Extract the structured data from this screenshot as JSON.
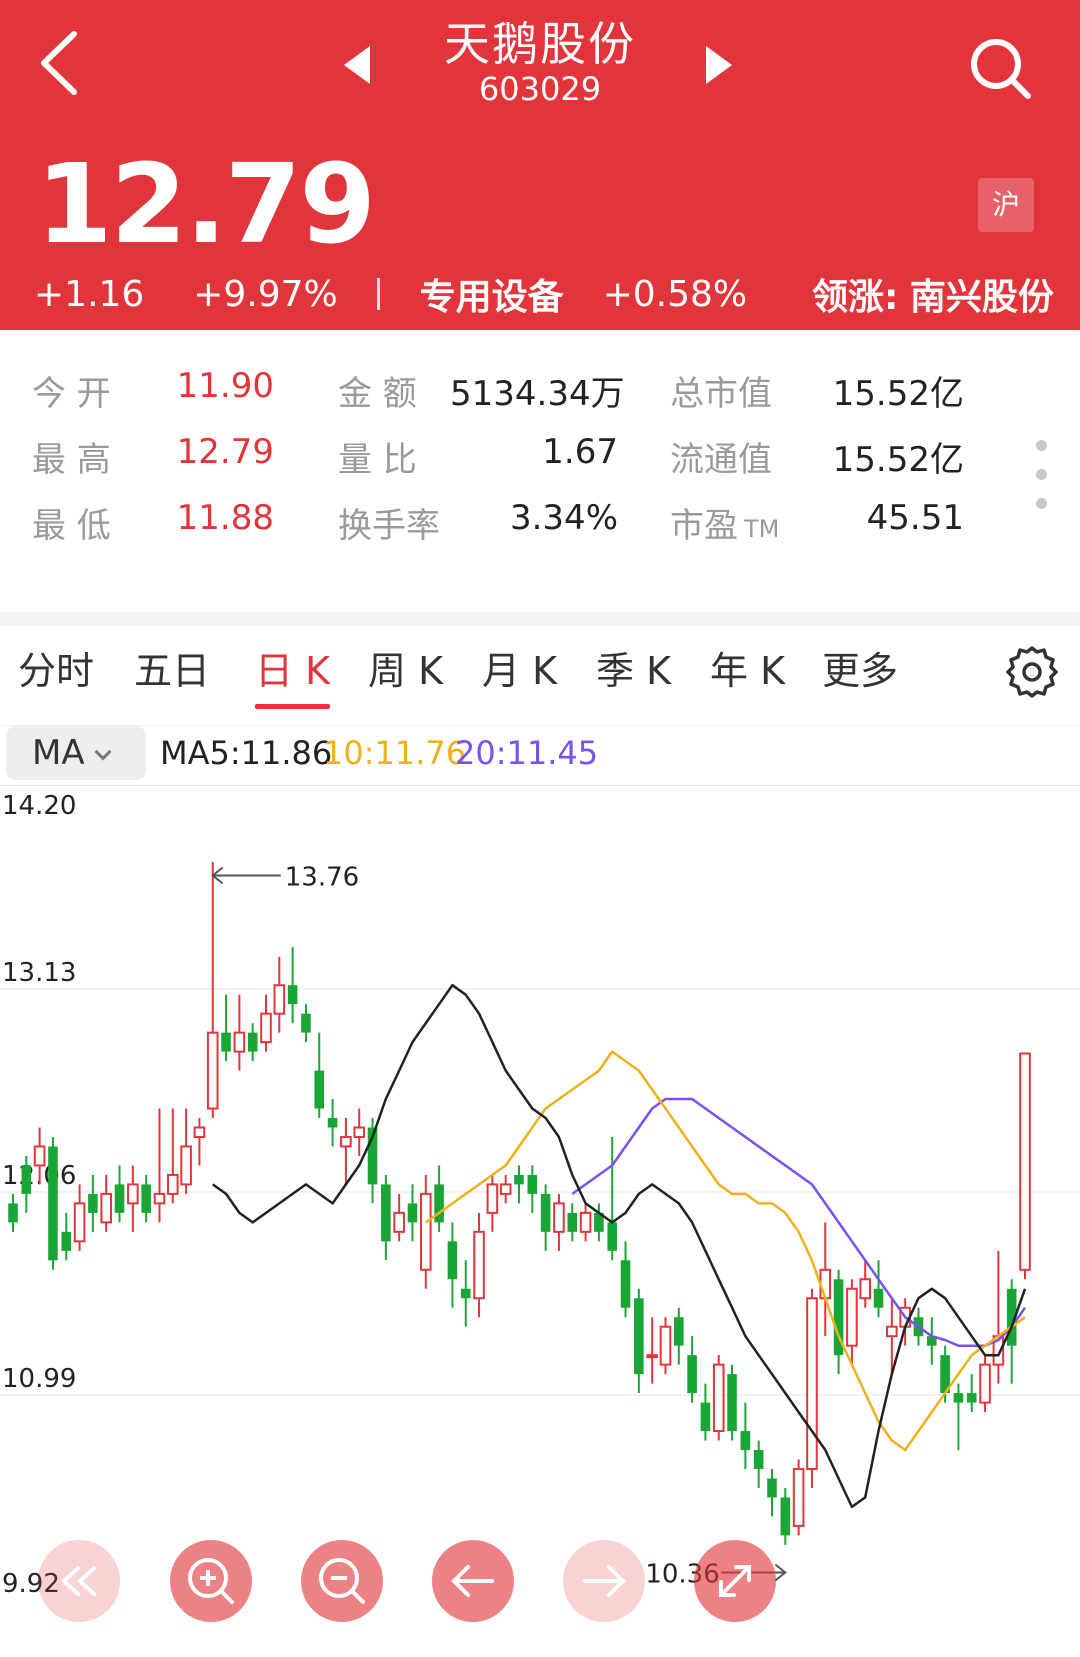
{
  "header": {
    "stock_name": "天鹅股份",
    "stock_code": "603029",
    "price": "12.79",
    "exchange_badge": "沪",
    "change": "+1.16",
    "change_pct": "+9.97%",
    "sector_name": "专用设备",
    "sector_change": "+0.58%",
    "leader_label": "领涨:",
    "leader_name": "南兴股份"
  },
  "stats": {
    "open_label": "今 开",
    "open_value": "11.90",
    "high_label": "最 高",
    "high_value": "12.79",
    "low_label": "最 低",
    "low_value": "11.88",
    "amount_label": "金 额",
    "amount_value": "5134.34万",
    "vol_ratio_label": "量 比",
    "vol_ratio_value": "1.67",
    "turnover_label": "换手率",
    "turnover_value": "3.34%",
    "mktcap_label": "总市值",
    "mktcap_value": "15.52亿",
    "float_cap_label": "流通值",
    "float_cap_value": "15.52亿",
    "pe_label": "市盈",
    "pe_suffix": "TM",
    "pe_value": "45.51"
  },
  "tabs": [
    {
      "label": "分时"
    },
    {
      "label": "五日"
    },
    {
      "label": "日 K"
    },
    {
      "label": "周 K"
    },
    {
      "label": "月 K"
    },
    {
      "label": "季 K"
    },
    {
      "label": "年 K"
    },
    {
      "label": "更多"
    }
  ],
  "active_tab": "日 K",
  "indicator": {
    "button_label": "MA",
    "ma5": "MA5:11.86",
    "ma10": "10:11.76",
    "ma20": "20:11.45"
  },
  "colors": {
    "header_red": "#e2353b",
    "up": "#e2353b",
    "down": "#1aa637",
    "ma5": "#222222",
    "ma10": "#f0b019",
    "ma20": "#7b4ff0"
  },
  "chart_data": {
    "type": "candlestick",
    "y_ticks": [
      "14.20",
      "13.13",
      "12.06",
      "10.99",
      "9.92"
    ],
    "ylim": [
      9.92,
      14.2
    ],
    "grid": true,
    "max_annotation": "13.76",
    "min_annotation": "10.36",
    "candles": [
      [
        12.0,
        11.9,
        12.05,
        11.85
      ],
      [
        12.2,
        12.05,
        12.25,
        11.95
      ],
      [
        12.2,
        12.3,
        12.4,
        12.1
      ],
      [
        12.3,
        11.7,
        12.35,
        11.65
      ],
      [
        11.85,
        11.75,
        11.95,
        11.7
      ],
      [
        11.8,
        12.0,
        12.1,
        11.75
      ],
      [
        12.05,
        11.95,
        12.15,
        11.85
      ],
      [
        11.9,
        12.05,
        12.15,
        11.85
      ],
      [
        12.1,
        11.95,
        12.2,
        11.9
      ],
      [
        12.0,
        12.1,
        12.2,
        11.85
      ],
      [
        12.1,
        11.95,
        12.15,
        11.9
      ],
      [
        12.0,
        12.05,
        12.5,
        11.9
      ],
      [
        12.05,
        12.15,
        12.5,
        12.0
      ],
      [
        12.1,
        12.3,
        12.5,
        12.05
      ],
      [
        12.35,
        12.4,
        12.45,
        12.2
      ],
      [
        12.5,
        12.9,
        13.8,
        12.45
      ],
      [
        12.9,
        12.8,
        13.1,
        12.75
      ],
      [
        12.8,
        12.9,
        13.1,
        12.7
      ],
      [
        12.9,
        12.8,
        12.95,
        12.75
      ],
      [
        12.85,
        13.0,
        13.1,
        12.8
      ],
      [
        13.0,
        13.15,
        13.3,
        12.9
      ],
      [
        13.15,
        13.05,
        13.35,
        12.95
      ],
      [
        13.0,
        12.9,
        13.05,
        12.85
      ],
      [
        12.7,
        12.5,
        12.9,
        12.45
      ],
      [
        12.45,
        12.4,
        12.55,
        12.3
      ],
      [
        12.3,
        12.35,
        12.45,
        12.1
      ],
      [
        12.35,
        12.4,
        12.5,
        12.25
      ],
      [
        12.4,
        12.1,
        12.45,
        12.0
      ],
      [
        12.1,
        11.8,
        12.15,
        11.7
      ],
      [
        11.85,
        11.95,
        12.05,
        11.8
      ],
      [
        12.0,
        11.9,
        12.1,
        11.8
      ],
      [
        11.65,
        12.05,
        12.15,
        11.55
      ],
      [
        12.1,
        11.9,
        12.2,
        11.85
      ],
      [
        11.8,
        11.6,
        11.9,
        11.45
      ],
      [
        11.55,
        11.5,
        11.7,
        11.35
      ],
      [
        11.5,
        11.85,
        11.95,
        11.4
      ],
      [
        11.95,
        12.1,
        12.15,
        11.85
      ],
      [
        12.05,
        12.1,
        12.15,
        12.0
      ],
      [
        12.15,
        12.1,
        12.2,
        12.0
      ],
      [
        12.15,
        12.05,
        12.2,
        11.95
      ],
      [
        12.05,
        11.85,
        12.1,
        11.75
      ],
      [
        11.85,
        12.0,
        12.05,
        11.75
      ],
      [
        11.95,
        11.85,
        12.0,
        11.8
      ],
      [
        11.85,
        11.95,
        12.0,
        11.8
      ],
      [
        11.95,
        11.85,
        12.0,
        11.8
      ],
      [
        11.9,
        11.75,
        12.35,
        11.7
      ],
      [
        11.7,
        11.45,
        11.8,
        11.4
      ],
      [
        11.5,
        11.1,
        11.55,
        11.0
      ],
      [
        11.2,
        11.2,
        11.4,
        11.05
      ],
      [
        11.15,
        11.35,
        11.4,
        11.1
      ],
      [
        11.4,
        11.25,
        11.45,
        11.15
      ],
      [
        11.2,
        11.0,
        11.3,
        10.95
      ],
      [
        10.95,
        10.8,
        11.05,
        10.75
      ],
      [
        10.8,
        11.15,
        11.2,
        10.75
      ],
      [
        11.1,
        10.8,
        11.15,
        10.75
      ],
      [
        10.8,
        10.7,
        10.95,
        10.6
      ],
      [
        10.7,
        10.6,
        10.75,
        10.5
      ],
      [
        10.55,
        10.45,
        10.6,
        10.35
      ],
      [
        10.45,
        10.25,
        10.5,
        10.2
      ],
      [
        10.3,
        10.6,
        10.65,
        10.25
      ],
      [
        10.6,
        11.5,
        11.55,
        10.5
      ],
      [
        11.5,
        11.65,
        11.9,
        11.3
      ],
      [
        11.6,
        11.2,
        11.65,
        11.1
      ],
      [
        11.25,
        11.55,
        11.6,
        11.15
      ],
      [
        11.5,
        11.6,
        11.7,
        11.45
      ],
      [
        11.55,
        11.45,
        11.7,
        11.4
      ],
      [
        11.3,
        11.35,
        11.5,
        11.1
      ],
      [
        11.35,
        11.45,
        11.5,
        11.25
      ],
      [
        11.4,
        11.3,
        11.45,
        11.25
      ],
      [
        11.3,
        11.25,
        11.4,
        11.15
      ],
      [
        11.2,
        11.0,
        11.25,
        10.95
      ],
      [
        11.0,
        10.95,
        11.05,
        10.7
      ],
      [
        11.0,
        10.95,
        11.1,
        10.9
      ],
      [
        10.95,
        11.15,
        11.2,
        10.9
      ],
      [
        11.15,
        11.3,
        11.75,
        11.05
      ],
      [
        11.55,
        11.25,
        11.6,
        11.05
      ],
      [
        11.65,
        12.79,
        12.79,
        11.6
      ]
    ],
    "ma5": [
      12.1,
      12.05,
      11.95,
      11.9,
      11.95,
      12.0,
      12.05,
      12.1,
      12.05,
      12.0,
      12.1,
      12.2,
      12.35,
      12.55,
      12.7,
      12.85,
      12.95,
      13.05,
      13.15,
      13.1,
      13.0,
      12.85,
      12.7,
      12.6,
      12.5,
      12.45,
      12.35,
      12.15,
      12.0,
      11.95,
      11.9,
      11.95,
      12.05,
      12.1,
      12.05,
      12.0,
      11.9,
      11.75,
      11.6,
      11.45,
      11.3,
      11.2,
      11.1,
      11.0,
      10.9,
      10.8,
      10.7,
      10.55,
      10.4,
      10.45,
      10.8,
      11.1,
      11.35,
      11.5,
      11.55,
      11.5,
      11.4,
      11.3,
      11.2,
      11.2,
      11.35,
      11.55
    ],
    "ma10": [
      11.9,
      11.95,
      12.0,
      12.05,
      12.1,
      12.15,
      12.2,
      12.3,
      12.4,
      12.5,
      12.55,
      12.6,
      12.65,
      12.7,
      12.8,
      12.75,
      12.7,
      12.6,
      12.5,
      12.4,
      12.3,
      12.2,
      12.1,
      12.05,
      12.05,
      12.0,
      12.0,
      11.95,
      11.85,
      11.7,
      11.5,
      11.3,
      11.15,
      11.0,
      10.85,
      10.75,
      10.7,
      10.8,
      10.9,
      11.0,
      11.1,
      11.2,
      11.25,
      11.3,
      11.35,
      11.4
    ],
    "ma20": [
      12.05,
      12.1,
      12.15,
      12.2,
      12.3,
      12.4,
      12.5,
      12.55,
      12.55,
      12.55,
      12.5,
      12.45,
      12.4,
      12.35,
      12.3,
      12.25,
      12.2,
      12.15,
      12.1,
      12.0,
      11.9,
      11.8,
      11.7,
      11.6,
      11.5,
      11.4,
      11.35,
      11.3,
      11.28,
      11.25,
      11.25,
      11.25,
      11.28,
      11.35,
      11.45
    ]
  },
  "controls": [
    {
      "name": "scroll-start-button",
      "icon": "double-chevron-left-icon"
    },
    {
      "name": "zoom-in-button",
      "icon": "zoom-in-icon"
    },
    {
      "name": "zoom-out-button",
      "icon": "zoom-out-icon"
    },
    {
      "name": "move-left-button",
      "icon": "arrow-left-icon"
    },
    {
      "name": "move-right-button",
      "icon": "arrow-right-icon"
    },
    {
      "name": "fullscreen-button",
      "icon": "expand-icon"
    }
  ]
}
